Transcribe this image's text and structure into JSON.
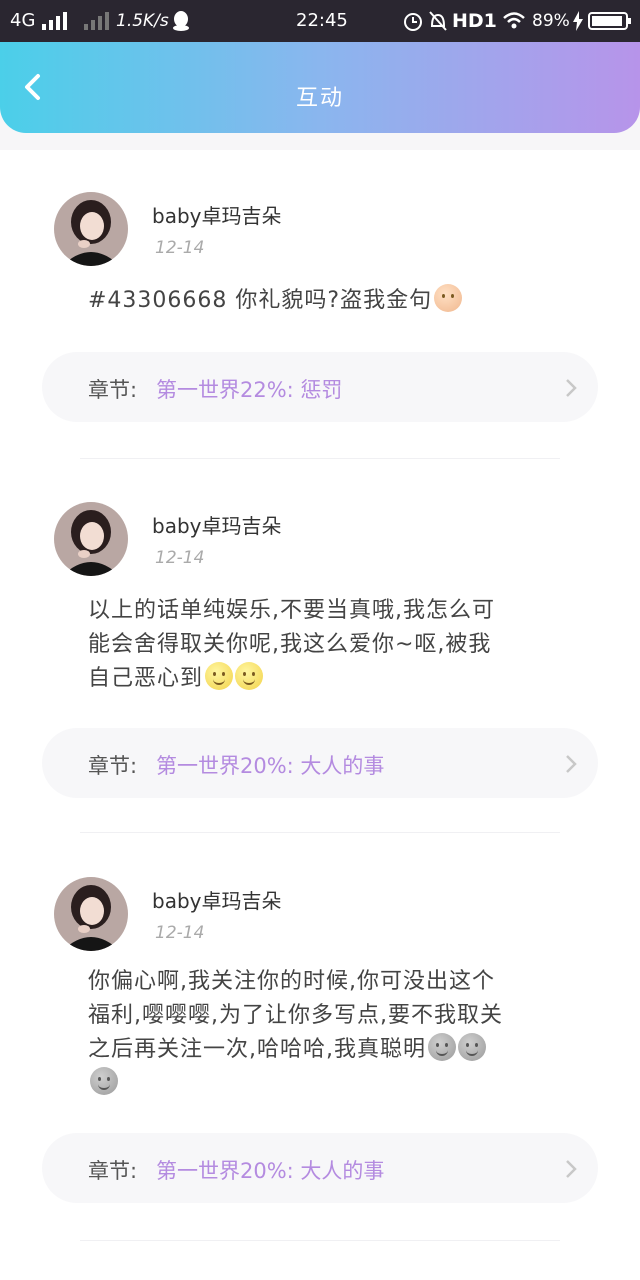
{
  "status_bar": {
    "network": "4G",
    "speed": "1.5K/s",
    "time": "22:45",
    "hd": "HD1",
    "battery": "89%"
  },
  "header": {
    "title": "互动"
  },
  "posts": [
    {
      "author": "baby卓玛吉朵",
      "date": "12-14",
      "text_lines": [
        "#43306668 你礼貌吗?盗我金句"
      ],
      "chapter_label": "章节:",
      "chapter_name": "第一世界22%: 惩罚"
    },
    {
      "author": "baby卓玛吉朵",
      "date": "12-14",
      "text_lines": [
        "以上的话单纯娱乐,不要当真哦,我怎么可",
        "能会舍得取关你呢,我这么爱你~呕,被我",
        "自己恶心到"
      ],
      "chapter_label": "章节:",
      "chapter_name": "第一世界20%: 大人的事"
    },
    {
      "author": "baby卓玛吉朵",
      "date": "12-14",
      "text_lines": [
        "你偏心啊,我关注你的时候,你可没出这个",
        "福利,嘤嘤嘤,为了让你多写点,要不我取关",
        "之后再关注一次,哈哈哈,我真聪明"
      ],
      "chapter_label": "章节:",
      "chapter_name": "第一世界20%: 大人的事"
    }
  ]
}
